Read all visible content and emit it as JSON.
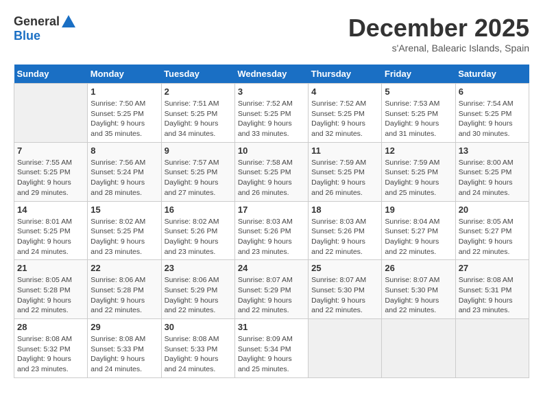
{
  "header": {
    "logo_general": "General",
    "logo_blue": "Blue",
    "month_title": "December 2025",
    "location": "s'Arenal, Balearic Islands, Spain"
  },
  "calendar": {
    "days_of_week": [
      "Sunday",
      "Monday",
      "Tuesday",
      "Wednesday",
      "Thursday",
      "Friday",
      "Saturday"
    ],
    "weeks": [
      [
        {
          "num": "",
          "info": ""
        },
        {
          "num": "1",
          "info": "Sunrise: 7:50 AM\nSunset: 5:25 PM\nDaylight: 9 hours\nand 35 minutes."
        },
        {
          "num": "2",
          "info": "Sunrise: 7:51 AM\nSunset: 5:25 PM\nDaylight: 9 hours\nand 34 minutes."
        },
        {
          "num": "3",
          "info": "Sunrise: 7:52 AM\nSunset: 5:25 PM\nDaylight: 9 hours\nand 33 minutes."
        },
        {
          "num": "4",
          "info": "Sunrise: 7:52 AM\nSunset: 5:25 PM\nDaylight: 9 hours\nand 32 minutes."
        },
        {
          "num": "5",
          "info": "Sunrise: 7:53 AM\nSunset: 5:25 PM\nDaylight: 9 hours\nand 31 minutes."
        },
        {
          "num": "6",
          "info": "Sunrise: 7:54 AM\nSunset: 5:25 PM\nDaylight: 9 hours\nand 30 minutes."
        }
      ],
      [
        {
          "num": "7",
          "info": "Sunrise: 7:55 AM\nSunset: 5:25 PM\nDaylight: 9 hours\nand 29 minutes."
        },
        {
          "num": "8",
          "info": "Sunrise: 7:56 AM\nSunset: 5:24 PM\nDaylight: 9 hours\nand 28 minutes."
        },
        {
          "num": "9",
          "info": "Sunrise: 7:57 AM\nSunset: 5:25 PM\nDaylight: 9 hours\nand 27 minutes."
        },
        {
          "num": "10",
          "info": "Sunrise: 7:58 AM\nSunset: 5:25 PM\nDaylight: 9 hours\nand 26 minutes."
        },
        {
          "num": "11",
          "info": "Sunrise: 7:59 AM\nSunset: 5:25 PM\nDaylight: 9 hours\nand 26 minutes."
        },
        {
          "num": "12",
          "info": "Sunrise: 7:59 AM\nSunset: 5:25 PM\nDaylight: 9 hours\nand 25 minutes."
        },
        {
          "num": "13",
          "info": "Sunrise: 8:00 AM\nSunset: 5:25 PM\nDaylight: 9 hours\nand 24 minutes."
        }
      ],
      [
        {
          "num": "14",
          "info": "Sunrise: 8:01 AM\nSunset: 5:25 PM\nDaylight: 9 hours\nand 24 minutes."
        },
        {
          "num": "15",
          "info": "Sunrise: 8:02 AM\nSunset: 5:25 PM\nDaylight: 9 hours\nand 23 minutes."
        },
        {
          "num": "16",
          "info": "Sunrise: 8:02 AM\nSunset: 5:26 PM\nDaylight: 9 hours\nand 23 minutes."
        },
        {
          "num": "17",
          "info": "Sunrise: 8:03 AM\nSunset: 5:26 PM\nDaylight: 9 hours\nand 23 minutes."
        },
        {
          "num": "18",
          "info": "Sunrise: 8:03 AM\nSunset: 5:26 PM\nDaylight: 9 hours\nand 22 minutes."
        },
        {
          "num": "19",
          "info": "Sunrise: 8:04 AM\nSunset: 5:27 PM\nDaylight: 9 hours\nand 22 minutes."
        },
        {
          "num": "20",
          "info": "Sunrise: 8:05 AM\nSunset: 5:27 PM\nDaylight: 9 hours\nand 22 minutes."
        }
      ],
      [
        {
          "num": "21",
          "info": "Sunrise: 8:05 AM\nSunset: 5:28 PM\nDaylight: 9 hours\nand 22 minutes."
        },
        {
          "num": "22",
          "info": "Sunrise: 8:06 AM\nSunset: 5:28 PM\nDaylight: 9 hours\nand 22 minutes."
        },
        {
          "num": "23",
          "info": "Sunrise: 8:06 AM\nSunset: 5:29 PM\nDaylight: 9 hours\nand 22 minutes."
        },
        {
          "num": "24",
          "info": "Sunrise: 8:07 AM\nSunset: 5:29 PM\nDaylight: 9 hours\nand 22 minutes."
        },
        {
          "num": "25",
          "info": "Sunrise: 8:07 AM\nSunset: 5:30 PM\nDaylight: 9 hours\nand 22 minutes."
        },
        {
          "num": "26",
          "info": "Sunrise: 8:07 AM\nSunset: 5:30 PM\nDaylight: 9 hours\nand 22 minutes."
        },
        {
          "num": "27",
          "info": "Sunrise: 8:08 AM\nSunset: 5:31 PM\nDaylight: 9 hours\nand 23 minutes."
        }
      ],
      [
        {
          "num": "28",
          "info": "Sunrise: 8:08 AM\nSunset: 5:32 PM\nDaylight: 9 hours\nand 23 minutes."
        },
        {
          "num": "29",
          "info": "Sunrise: 8:08 AM\nSunset: 5:33 PM\nDaylight: 9 hours\nand 24 minutes."
        },
        {
          "num": "30",
          "info": "Sunrise: 8:08 AM\nSunset: 5:33 PM\nDaylight: 9 hours\nand 24 minutes."
        },
        {
          "num": "31",
          "info": "Sunrise: 8:09 AM\nSunset: 5:34 PM\nDaylight: 9 hours\nand 25 minutes."
        },
        {
          "num": "",
          "info": ""
        },
        {
          "num": "",
          "info": ""
        },
        {
          "num": "",
          "info": ""
        }
      ]
    ]
  }
}
